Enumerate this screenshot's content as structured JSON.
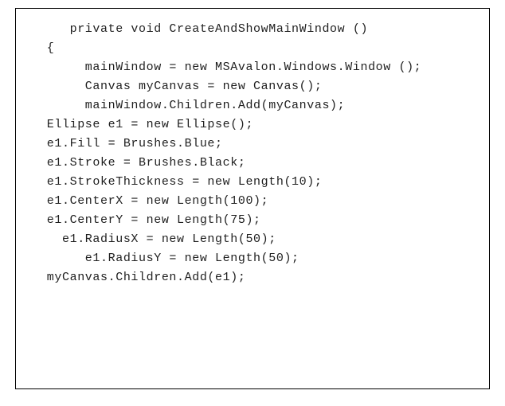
{
  "code": {
    "lines": [
      "      private void CreateAndShowMainWindow ()",
      "   {",
      "",
      "        mainWindow = new MSAvalon.Windows.Window ();",
      "",
      "",
      "        Canvas myCanvas = new Canvas();",
      "        mainWindow.Children.Add(myCanvas);",
      "",
      "",
      "   Ellipse e1 = new Ellipse();",
      "   e1.Fill = Brushes.Blue;",
      "   e1.Stroke = Brushes.Black;",
      "   e1.StrokeThickness = new Length(10);",
      "   e1.CenterX = new Length(100);",
      "   e1.CenterY = new Length(75);",
      "     e1.RadiusX = new Length(50);",
      "        e1.RadiusY = new Length(50);",
      "",
      "",
      "   myCanvas.Children.Add(e1);"
    ]
  }
}
